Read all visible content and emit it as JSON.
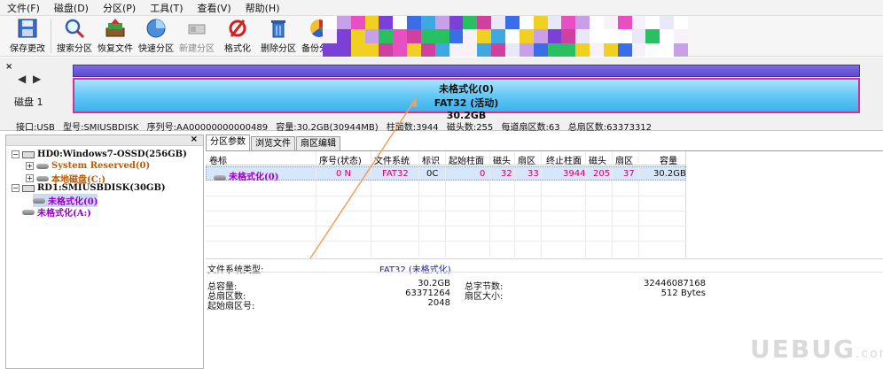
{
  "menu": {
    "items": [
      "文件(F)",
      "磁盘(D)",
      "分区(P)",
      "工具(T)",
      "查看(V)",
      "帮助(H)"
    ]
  },
  "toolbar": {
    "buttons": [
      {
        "label": "保存更改",
        "icon": "save-icon"
      },
      {
        "label": "搜索分区",
        "icon": "search-icon"
      },
      {
        "label": "恢复文件",
        "icon": "recover-files-icon"
      },
      {
        "label": "快速分区",
        "icon": "quick-partition-icon"
      },
      {
        "label": "新建分区",
        "icon": "new-partition-icon"
      },
      {
        "label": "格式化",
        "icon": "format-icon"
      },
      {
        "label": "删除分区",
        "icon": "delete-partition-icon"
      },
      {
        "label": "备份分区",
        "icon": "backup-partition-icon"
      }
    ]
  },
  "disk_panel": {
    "close": "×",
    "nav": "◀ ▶",
    "disk_label": "磁盘 1",
    "partition": {
      "name": "未格式化(0)",
      "fs": "FAT32 (活动)",
      "size": "30.2GB"
    },
    "info": [
      "接口:USB",
      "型号:SMIUSBDISK",
      "序列号:AA00000000000489",
      "容量:30.2GB(30944MB)",
      "柱面数:3944",
      "磁头数:255",
      "每道扇区数:63",
      "总扇区数:63373312"
    ]
  },
  "tree": {
    "close": "×",
    "nodes": [
      {
        "text": "HD0:Windows7-OSSD(256GB)",
        "expander": "−",
        "color": "#111111"
      },
      {
        "text": "System Reserved(0)",
        "expander": "+",
        "color": "#c05a00"
      },
      {
        "text": "本地磁盘(C:)",
        "expander": "+",
        "color": "#c05a00"
      },
      {
        "text": "RD1:SMIUSBDISK(30GB)",
        "expander": "−",
        "color": "#111111"
      },
      {
        "text": "未格式化(0)",
        "expander": "",
        "color": "#9b00c8"
      },
      {
        "text": "未格式化(A:)",
        "expander": "",
        "color": "#9b00c8"
      }
    ]
  },
  "tabs": [
    "分区参数",
    "浏览文件",
    "扇区编辑"
  ],
  "grid": {
    "headers": [
      "卷标",
      "序号(状态)",
      "文件系统",
      "标识",
      "起始柱面",
      "磁头",
      "扇区",
      "终止柱面",
      "磁头",
      "扇区",
      "容量"
    ],
    "row": [
      "未格式化(0)",
      "0 N",
      "FAT32",
      "0C",
      "0",
      "32",
      "33",
      "3944",
      "205",
      "37",
      "30.2GB"
    ]
  },
  "props": {
    "fs_type_label": "文件系统类型:",
    "fs_type_value": "FAT32 (未格式化)",
    "total_capacity_label": "总容量:",
    "total_capacity_value": "30.2GB",
    "total_sectors_label": "总扇区数:",
    "total_sectors_value": "63371264",
    "start_sector_label": "起始扇区号:",
    "start_sector_value": "2048",
    "total_bytes_label": "总字节数:",
    "total_bytes_value": "32446087168",
    "sector_size_label": "扇区大小:",
    "sector_size_value": "512 Bytes"
  },
  "watermark": {
    "text": "UEBUG",
    "suffix": ".com"
  },
  "colors": {
    "disk_bar": "#5a4bd0",
    "partition_fill": "#64c8f5",
    "partition_border": "#d9308f",
    "highlight_text": "#d0006a",
    "selected_row": "#d6e6fb"
  }
}
